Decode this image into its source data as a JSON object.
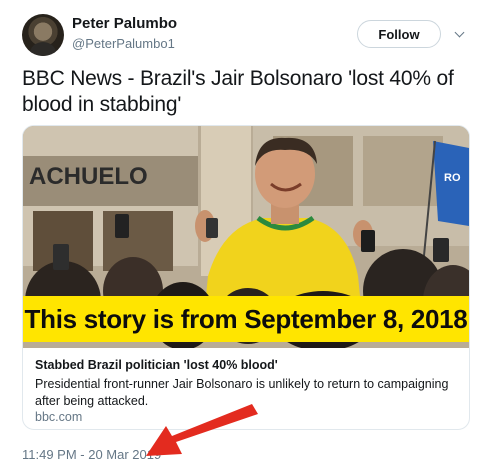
{
  "author": {
    "display_name": "Peter Palumbo",
    "handle": "@PeterPalumbo1"
  },
  "follow_button": {
    "label": "Follow"
  },
  "tweet": {
    "text": "BBC News - Brazil's Jair Bolsonaro 'lost 40% of blood in stabbing'",
    "timestamp": "11:49 PM - 20 Mar 2019"
  },
  "card": {
    "banner": "This story is from September 8, 2018",
    "storefront_sign": "ACHUELO",
    "flag_text": "RO",
    "title": "Stabbed Brazil politician 'lost 40% blood'",
    "description": "Presidential front-runner Jair Bolsonaro is unlikely to return to campaigning after being attacked.",
    "domain": "bbc.com"
  },
  "colors": {
    "banner_bg": "#ffe500",
    "arrow": "#e32b1f",
    "muted_text": "#657786",
    "border": "#e1e8ed"
  }
}
